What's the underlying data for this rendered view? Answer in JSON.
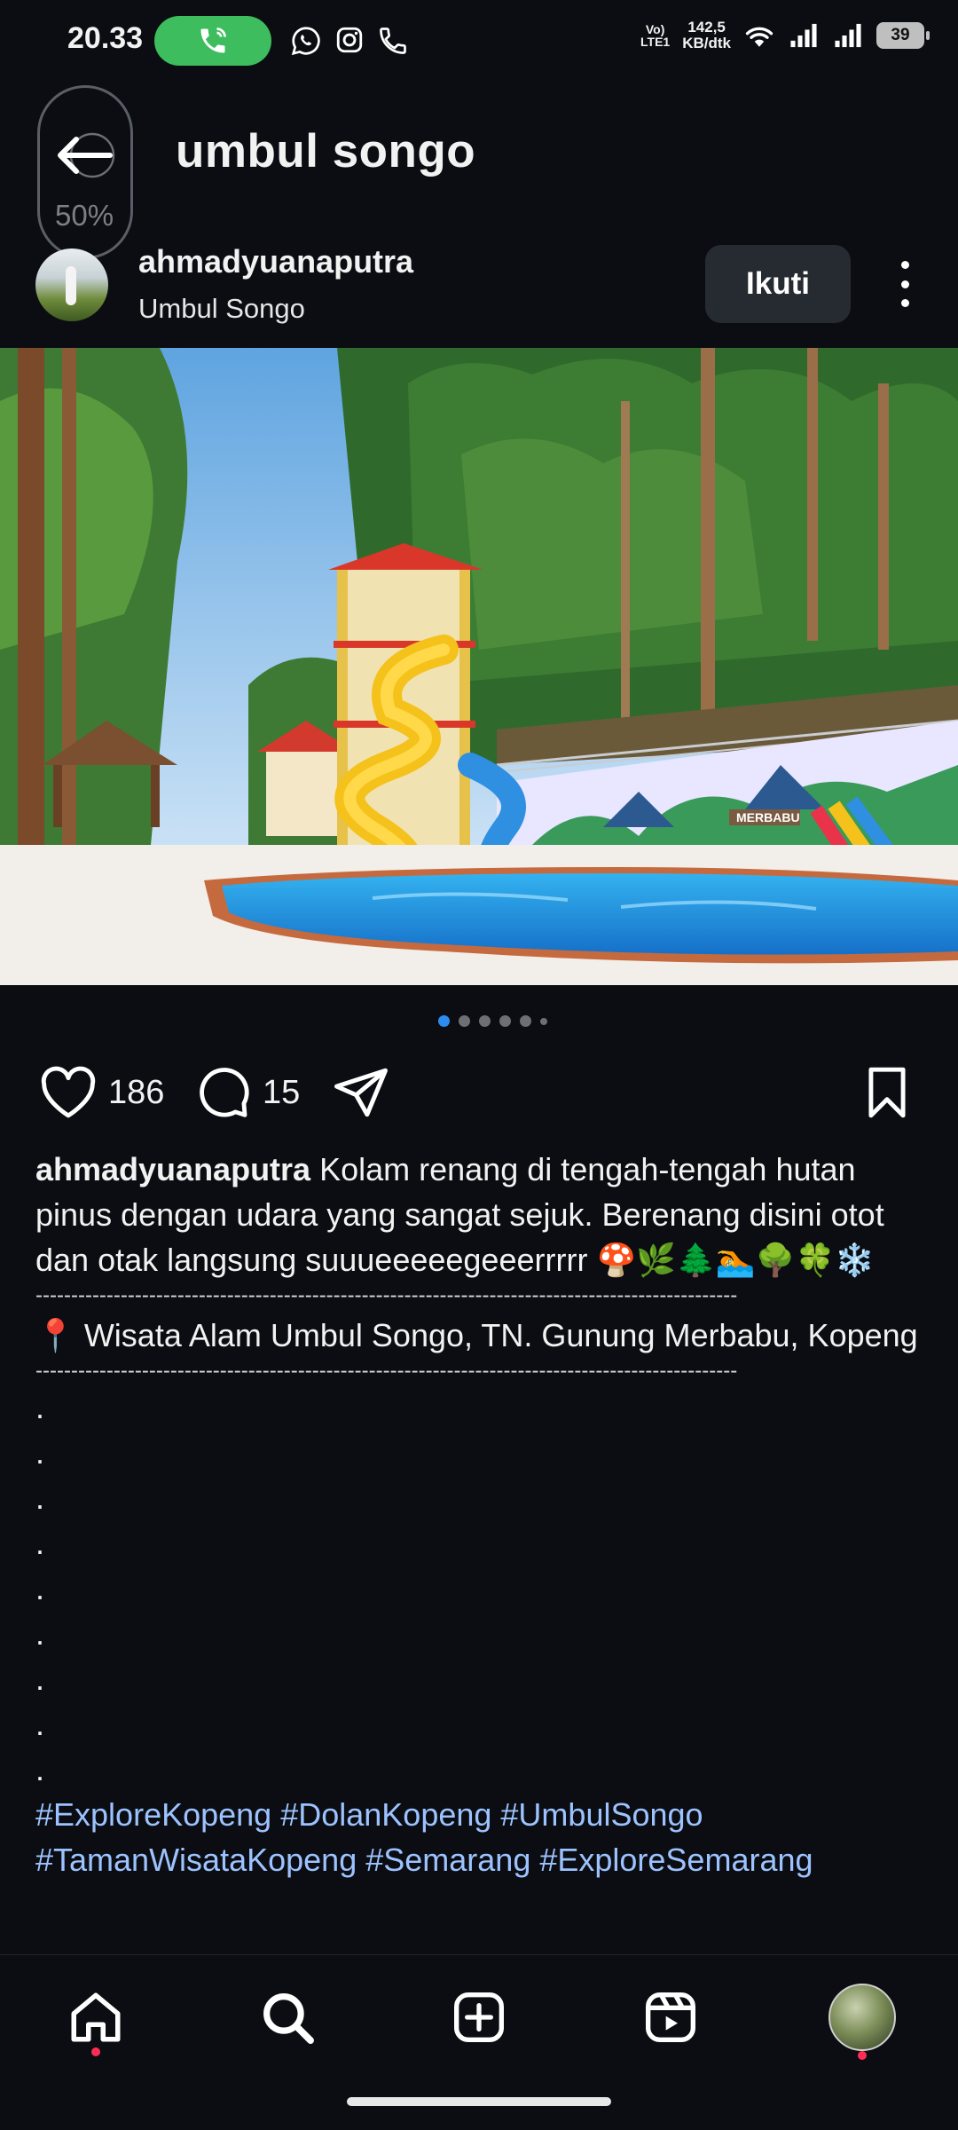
{
  "status_bar": {
    "time": "20.33",
    "network_top": "Vo)",
    "network_bottom": "LTE1",
    "speed_top": "142,5",
    "speed_bottom": "KB/dtk",
    "battery": "39"
  },
  "header": {
    "title": "umbul songo",
    "zoom_percent": "50%"
  },
  "post": {
    "username": "ahmadyuanaputra",
    "location": "Umbul Songo",
    "follow_label": "Ikuti",
    "likes": "186",
    "comments": "15",
    "carousel": {
      "count": 6,
      "active_index": 0
    }
  },
  "caption": {
    "username": "ahmadyuanaputra",
    "text": " Kolam renang di tengah-tengah hutan pinus dengan udara yang sangat sejuk. Berenang disini otot dan otak langsung suuueeeeegeeerrrrr 🍄🌿🌲🏊🌳🍀❄️",
    "separator": "---------------------------------------------------------------------------------------------------",
    "location_line": "📍 Wisata Alam Umbul Songo, TN. Gunung Merbabu, Kopeng",
    "dot_lines": [
      ".",
      ".",
      ".",
      ".",
      ".",
      ".",
      ".",
      ".",
      "."
    ],
    "hashtags_line1": "#ExploreKopeng #DolanKopeng #UmbulSongo",
    "hashtags_line2": "#TamanWisataKopeng #Semarang #ExploreSemarang"
  },
  "image_text": {
    "mural_sign": "MERBABU"
  },
  "colors": {
    "background": "#0b0d12",
    "accent_blue": "#2d8cf0",
    "hashtag": "#9cc3ff",
    "call_pill": "#3dbd5d",
    "notification": "#ff2d55"
  },
  "icons": {
    "status": [
      "phone-call-icon",
      "whatsapp-icon",
      "instagram-icon",
      "phone-icon",
      "wifi-icon",
      "signal-icon",
      "battery-icon"
    ],
    "actions": [
      "heart-icon",
      "comment-icon",
      "share-icon",
      "bookmark-icon"
    ],
    "nav": [
      "home-icon",
      "search-icon",
      "add-icon",
      "reels-icon",
      "profile-avatar"
    ]
  }
}
